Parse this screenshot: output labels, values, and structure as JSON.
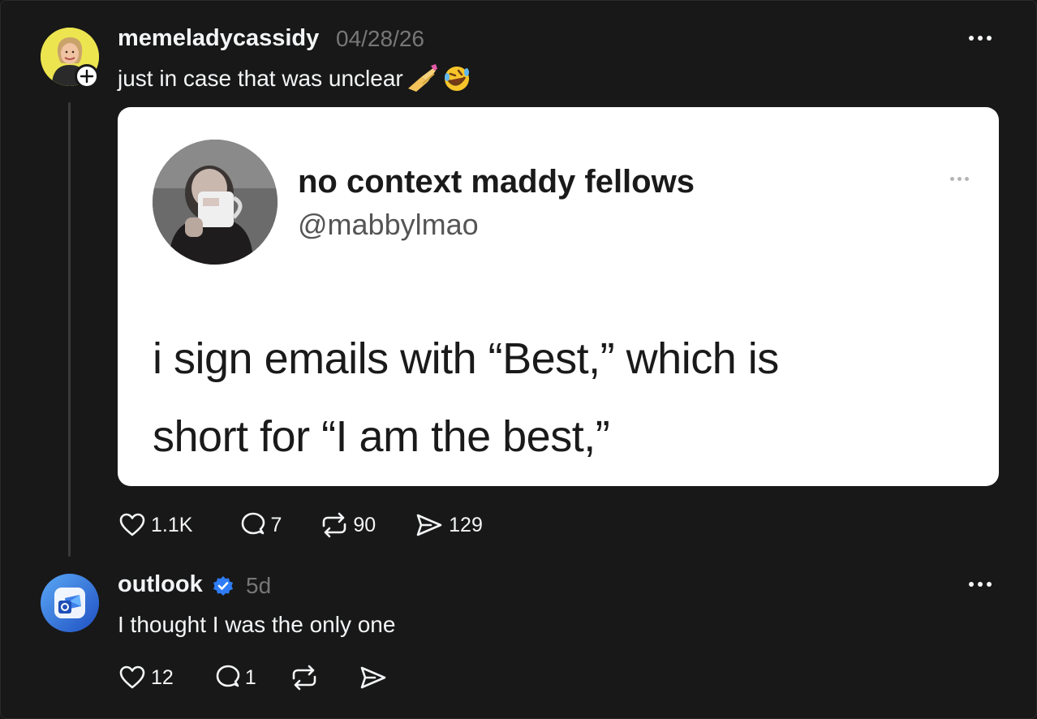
{
  "post": {
    "username": "memeladycassidy",
    "timestamp": "04/28/26",
    "text": "just in case that was unclear",
    "emojis": [
      "nail-polish-emoji",
      "rolling-on-floor-laughing-emoji"
    ],
    "embed": {
      "name": "no context maddy fellows",
      "handle": "@mabbylmao",
      "body_line1": "i sign emails with “Best,” which is",
      "body_line2": "short for “I am the best,”"
    },
    "stats": {
      "likes": "1.1K",
      "replies": "7",
      "reposts": "90",
      "shares": "129"
    }
  },
  "reply": {
    "username": "outlook",
    "verified": true,
    "timestamp": "5d",
    "text": "I thought I was the only one",
    "stats": {
      "likes": "12",
      "replies": "1"
    }
  },
  "colors": {
    "background": "#181818",
    "text": "#f3f5f7",
    "muted": "#777777",
    "verified_blue": "#2f7cf6"
  }
}
